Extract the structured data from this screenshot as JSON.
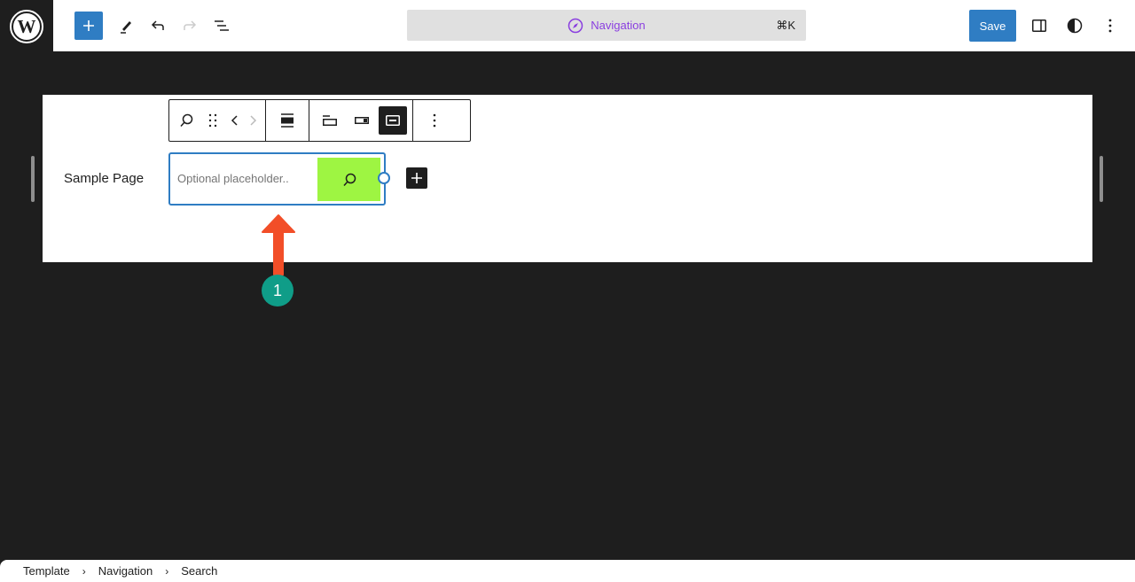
{
  "topbar": {
    "logo": "wordpress-logo",
    "tools": [
      {
        "name": "add-block-button",
        "icon": "plus-icon"
      },
      {
        "name": "tools-button",
        "icon": "pencil-icon"
      },
      {
        "name": "undo-button",
        "icon": "undo-icon"
      },
      {
        "name": "redo-button",
        "icon": "redo-icon",
        "disabled": true
      },
      {
        "name": "document-overview-button",
        "icon": "list-view-icon"
      }
    ],
    "command_bar": {
      "label": "Navigation",
      "icon": "compass-icon",
      "shortcut": "⌘K"
    },
    "save_label": "Save",
    "right_tools": [
      "settings-sidebar-icon",
      "styles-contrast-icon",
      "options-more-icon"
    ]
  },
  "block_toolbar": {
    "groups": [
      [
        "search-block-icon",
        "drag-handle-icon",
        "move-left-icon",
        "move-right-icon"
      ],
      [
        "justify-icon"
      ],
      [
        "button-outside-icon",
        "button-inside-icon",
        "button-only-icon"
      ],
      [
        "more-options-icon"
      ]
    ],
    "active": "button-only-icon"
  },
  "canvas": {
    "nav_item": "Sample Page",
    "search": {
      "placeholder": "Optional placeholder.."
    },
    "annotation_number": "1"
  },
  "colors": {
    "accent": "#2f7dc3",
    "search_button": "#9ef542",
    "command_text": "#8a3ee0",
    "arrow": "#f24e28",
    "badge": "#0f9d88"
  },
  "breadcrumbs": [
    "Template",
    "Navigation",
    "Search"
  ]
}
